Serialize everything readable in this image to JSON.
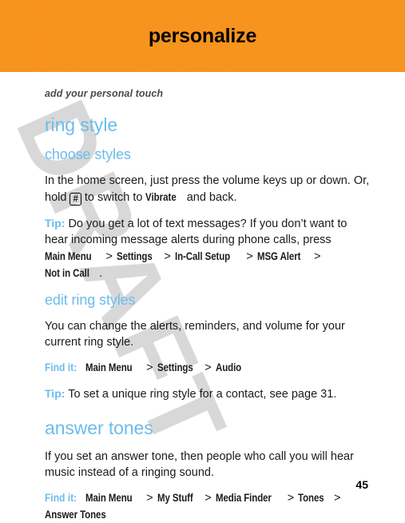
{
  "banner": {
    "title": "personalize",
    "bg_color": "#F7941E"
  },
  "colors": {
    "accent_blue": "#6CBCEC",
    "orange": "#F7941E",
    "watermark_gray": "#D8D8D8",
    "body_text": "#1B1B1B"
  },
  "watermark": {
    "text": "DRAFT"
  },
  "content": {
    "subtitle": "add your personal touch",
    "heading_ring_style": "ring style",
    "heading_choose_styles": "choose styles",
    "choose_styles_p1_a": "In the home screen, just press the volume keys up or down. Or, hold",
    "choose_styles_key": "#",
    "choose_styles_p1_b": "to switch to",
    "choose_styles_vibrate": "Vibrate",
    "choose_styles_p1_c": "and back.",
    "tip1_label": "Tip:",
    "tip1_text": "Do you get a lot of text messages? If you don’t want to hear incoming message alerts during phone calls, press",
    "tip1_path": [
      "Main Menu",
      "Settings",
      "In-Call Setup",
      "MSG Alert",
      "Not in Call"
    ],
    "tip1_period": ".",
    "heading_edit_ring_styles": "edit ring styles",
    "edit_ring_styles_p": "You can change the alerts, reminders, and volume for your current ring style.",
    "findit1_label": "Find it:",
    "findit1_path": [
      "Main Menu",
      "Settings",
      "Audio"
    ],
    "tip2_label": "Tip:",
    "tip2_text": "To set a unique ring style for a contact, see page 31.",
    "heading_answer_tones": "answer tones",
    "answer_tones_p": "If you set an answer tone, then people who call you will hear music instead of a ringing sound.",
    "findit2_label": "Find it:",
    "findit2_path": [
      "Main Menu",
      "My Stuff",
      "Media Finder",
      "Tones",
      "Answer Tones"
    ],
    "path_separator": ">"
  },
  "footer": {
    "page_number": "45"
  }
}
